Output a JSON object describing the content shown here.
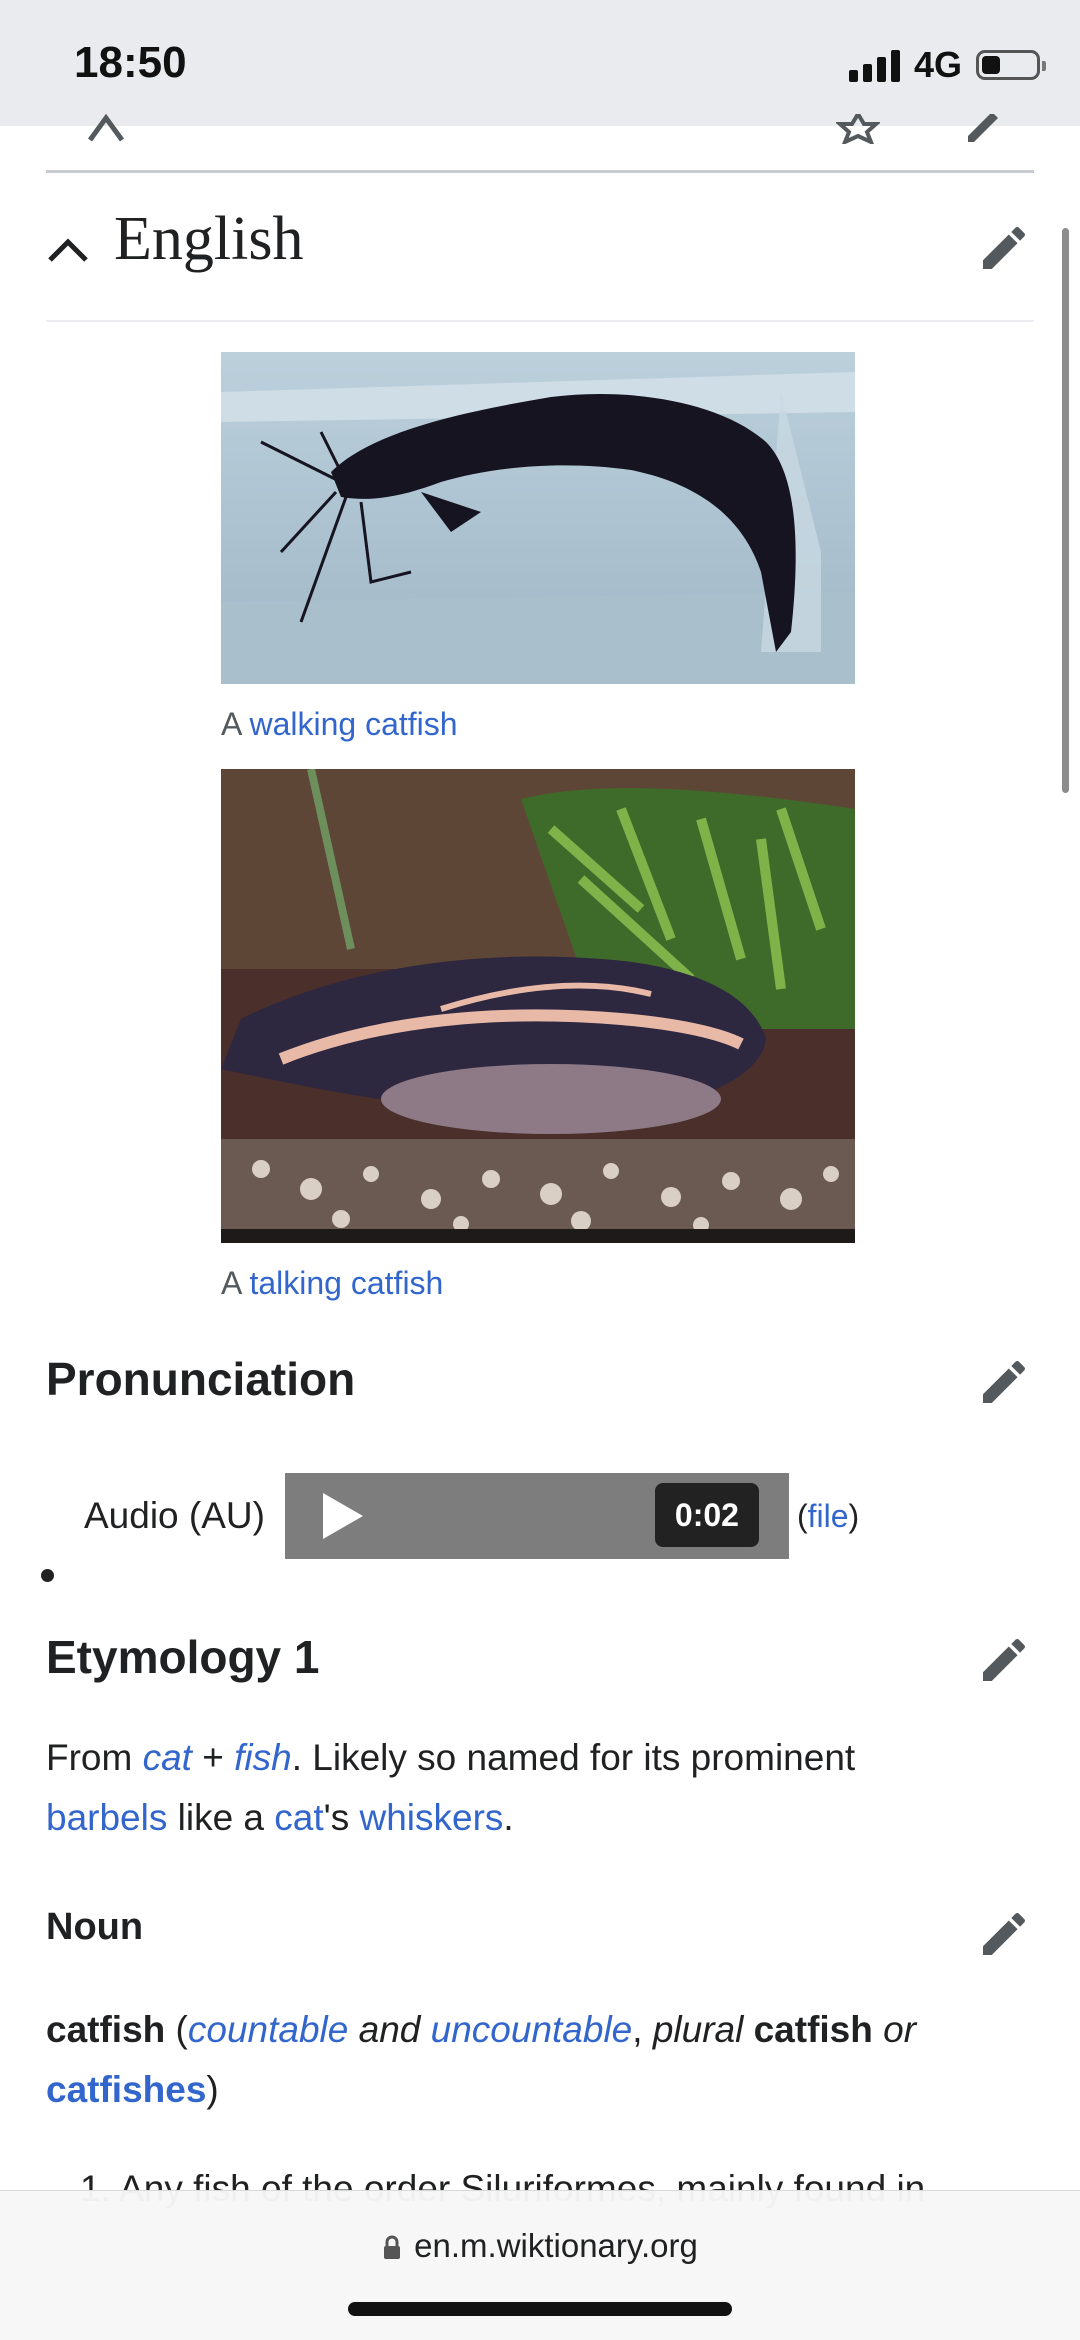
{
  "status_bar": {
    "time": "18:50",
    "network": "4G",
    "battery_level": 0.35
  },
  "english_section": {
    "title": "English"
  },
  "figures": [
    {
      "caption_prefix": "A",
      "caption_link": "walking catfish"
    },
    {
      "caption_prefix": "A",
      "caption_link": "talking catfish"
    }
  ],
  "pronunciation": {
    "heading": "Pronunciation",
    "audio_label": "Audio (AU)",
    "duration": "0:02",
    "file_open": "(",
    "file_link": "file",
    "file_close": ")"
  },
  "etymology": {
    "heading": "Etymology 1",
    "t1": "From ",
    "l_cat": "cat",
    "t2": " + ",
    "l_fish": "fish",
    "t3": ". Likely so named for its prominent",
    "l_barbels": "barbels",
    "t4": " like a ",
    "l_cat2": "cat",
    "t5": "'s ",
    "l_whiskers": "whiskers",
    "t6": "."
  },
  "noun": {
    "heading": "Noun",
    "headword": "catfish",
    "p_open": " (",
    "countable": "countable",
    "and": " and ",
    "uncountable": "uncountable",
    "comma": ", ",
    "plural": "plural",
    "space": " ",
    "headword2": "catfish",
    "or": " or",
    "catfishes": "catfishes",
    "p_close": ")",
    "definition_partial": "1. Any fish of the order Siluriformes, mainly found in"
  },
  "browser": {
    "url": "en.m.wiktionary.org"
  }
}
